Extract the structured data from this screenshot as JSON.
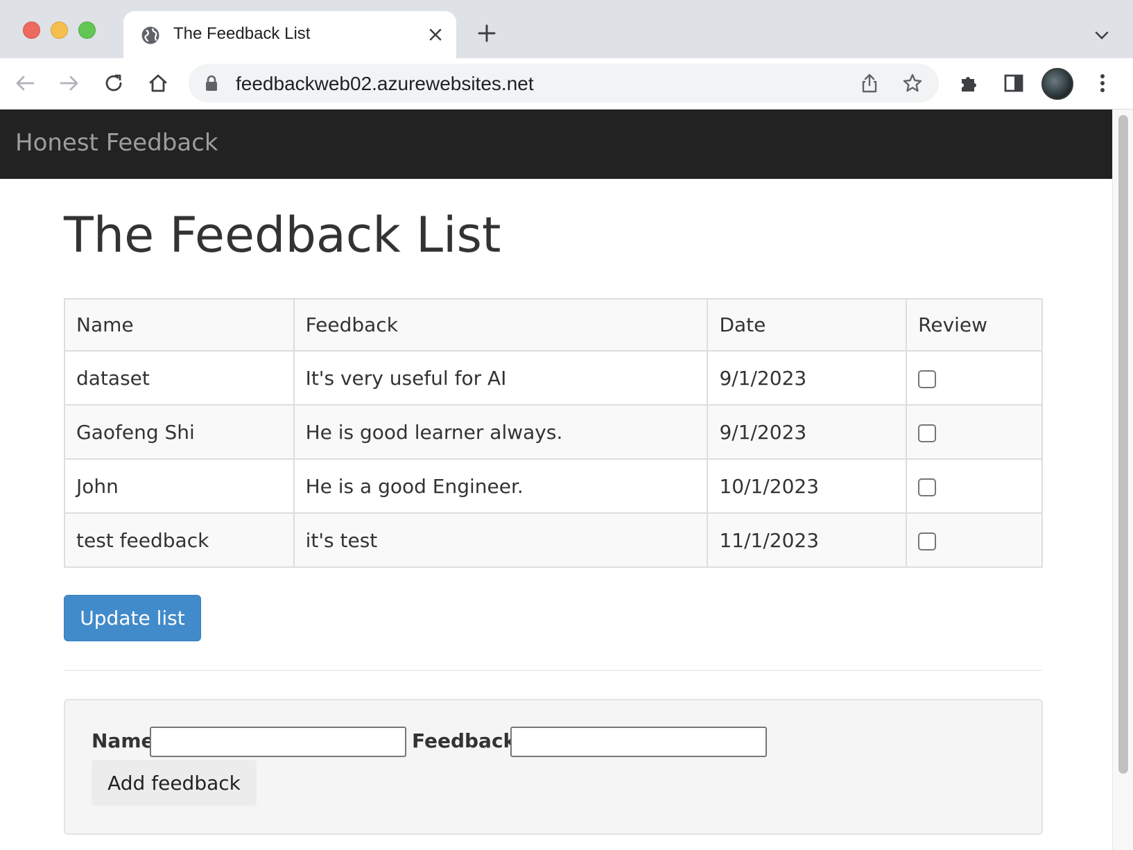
{
  "browser": {
    "tab_title": "The Feedback List",
    "url": "feedbackweb02.azurewebsites.net",
    "colors": {
      "close": "#ed6a5e",
      "minimize": "#f5bf4f",
      "maximize": "#62c554"
    }
  },
  "navbar": {
    "brand": "Honest Feedback",
    "background": "#222222"
  },
  "page": {
    "title": "The Feedback List"
  },
  "table": {
    "headers": {
      "name": "Name",
      "feedback": "Feedback",
      "date": "Date",
      "review": "Review"
    },
    "rows": [
      {
        "name": "dataset",
        "feedback": "It's very useful for AI",
        "date": "9/1/2023",
        "review": false
      },
      {
        "name": "Gaofeng Shi",
        "feedback": "He is good learner always.",
        "date": "9/1/2023",
        "review": false
      },
      {
        "name": "John",
        "feedback": "He is a good Engineer.",
        "date": "10/1/2023",
        "review": false
      },
      {
        "name": "test feedback",
        "feedback": "it's test",
        "date": "11/1/2023",
        "review": false
      }
    ]
  },
  "actions": {
    "update_label": "Update list",
    "update_color": "#428bca"
  },
  "form": {
    "name_label": "Name:",
    "name_value": "",
    "feedback_label": "Feedback:",
    "feedback_value": "",
    "add_label": "Add feedback"
  }
}
